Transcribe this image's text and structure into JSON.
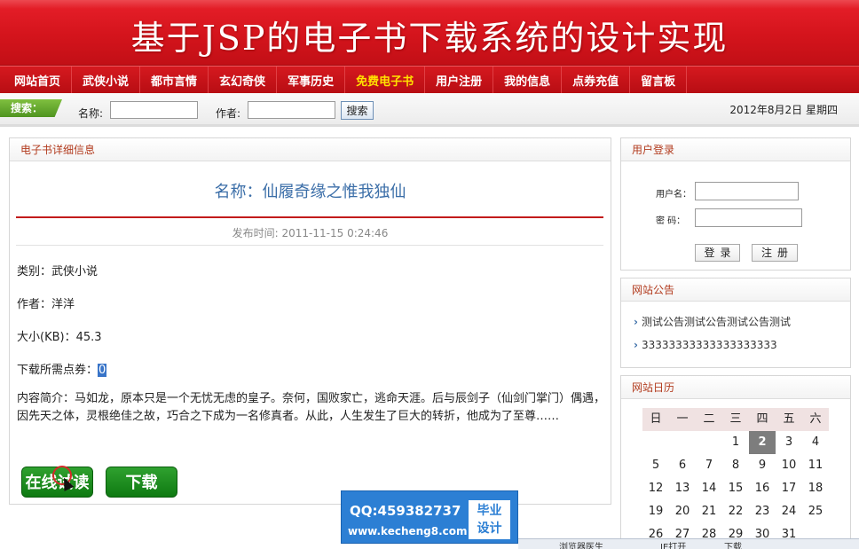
{
  "header": {
    "title": "基于JSP的电子书下载系统的设计实现"
  },
  "nav": {
    "items": [
      {
        "label": "网站首页"
      },
      {
        "label": "武侠小说"
      },
      {
        "label": "都市言情"
      },
      {
        "label": "玄幻奇侠"
      },
      {
        "label": "军事历史"
      },
      {
        "label": "免费电子书"
      },
      {
        "label": "用户注册"
      },
      {
        "label": "我的信息"
      },
      {
        "label": "点券充值"
      },
      {
        "label": "留言板"
      }
    ],
    "active_index": 5,
    "active_color": "#ffe000"
  },
  "search": {
    "tag": "搜索：",
    "name_label": "名称:",
    "author_label": "作者:",
    "button": "搜索",
    "date": "2012年8月2日 星期四"
  },
  "detail": {
    "panel_title": "电子书详细信息",
    "name_line": "名称：仙履奇缘之惟我独仙",
    "publish_time": "发布时间: 2011-11-15 0:24:46",
    "category": "类别：武侠小说",
    "author": "作者：洋洋",
    "size": "大小(KB)：45.3",
    "points_label": "下载所需点券：",
    "points_value": "0",
    "intro": "内容简介：马如龙，原本只是一个无忧无虑的皇子。奈何，国败家亡，逃命天涯。后与辰剑子（仙剑门掌门）偶遇，因先天之体，灵根绝佳之故，巧合之下成为一名修真者。从此，人生发生了巨大的转折，他成为了至尊……",
    "read_button": "在线试读",
    "download_button": "下载"
  },
  "login": {
    "panel_title": "用户登录",
    "username_label": "用户名：",
    "password_label": "密  码：",
    "login_button": "登录",
    "register_button": "注册"
  },
  "notice": {
    "panel_title": "网站公告",
    "items": [
      "测试公告测试公告测试公告测试",
      "33333333333333333333"
    ]
  },
  "calendar": {
    "panel_title": "网站日历",
    "weekdays": [
      "日",
      "一",
      "二",
      "三",
      "四",
      "五",
      "六"
    ],
    "rows": [
      [
        "",
        "",
        "",
        "1",
        "2",
        "3",
        "4"
      ],
      [
        "5",
        "6",
        "7",
        "8",
        "9",
        "10",
        "11"
      ],
      [
        "12",
        "13",
        "14",
        "15",
        "16",
        "17",
        "18"
      ],
      [
        "19",
        "20",
        "21",
        "22",
        "23",
        "24",
        "25"
      ],
      [
        "26",
        "27",
        "28",
        "29",
        "30",
        "31",
        ""
      ]
    ],
    "today": "2"
  },
  "ad": {
    "qq": "QQ:459382737",
    "url": "www.kecheng8.com",
    "badge_line1": "毕业",
    "badge_line2": "设计"
  },
  "statusbar": {
    "items": [
      "浏览器医生",
      "IE打开",
      "下载"
    ]
  }
}
